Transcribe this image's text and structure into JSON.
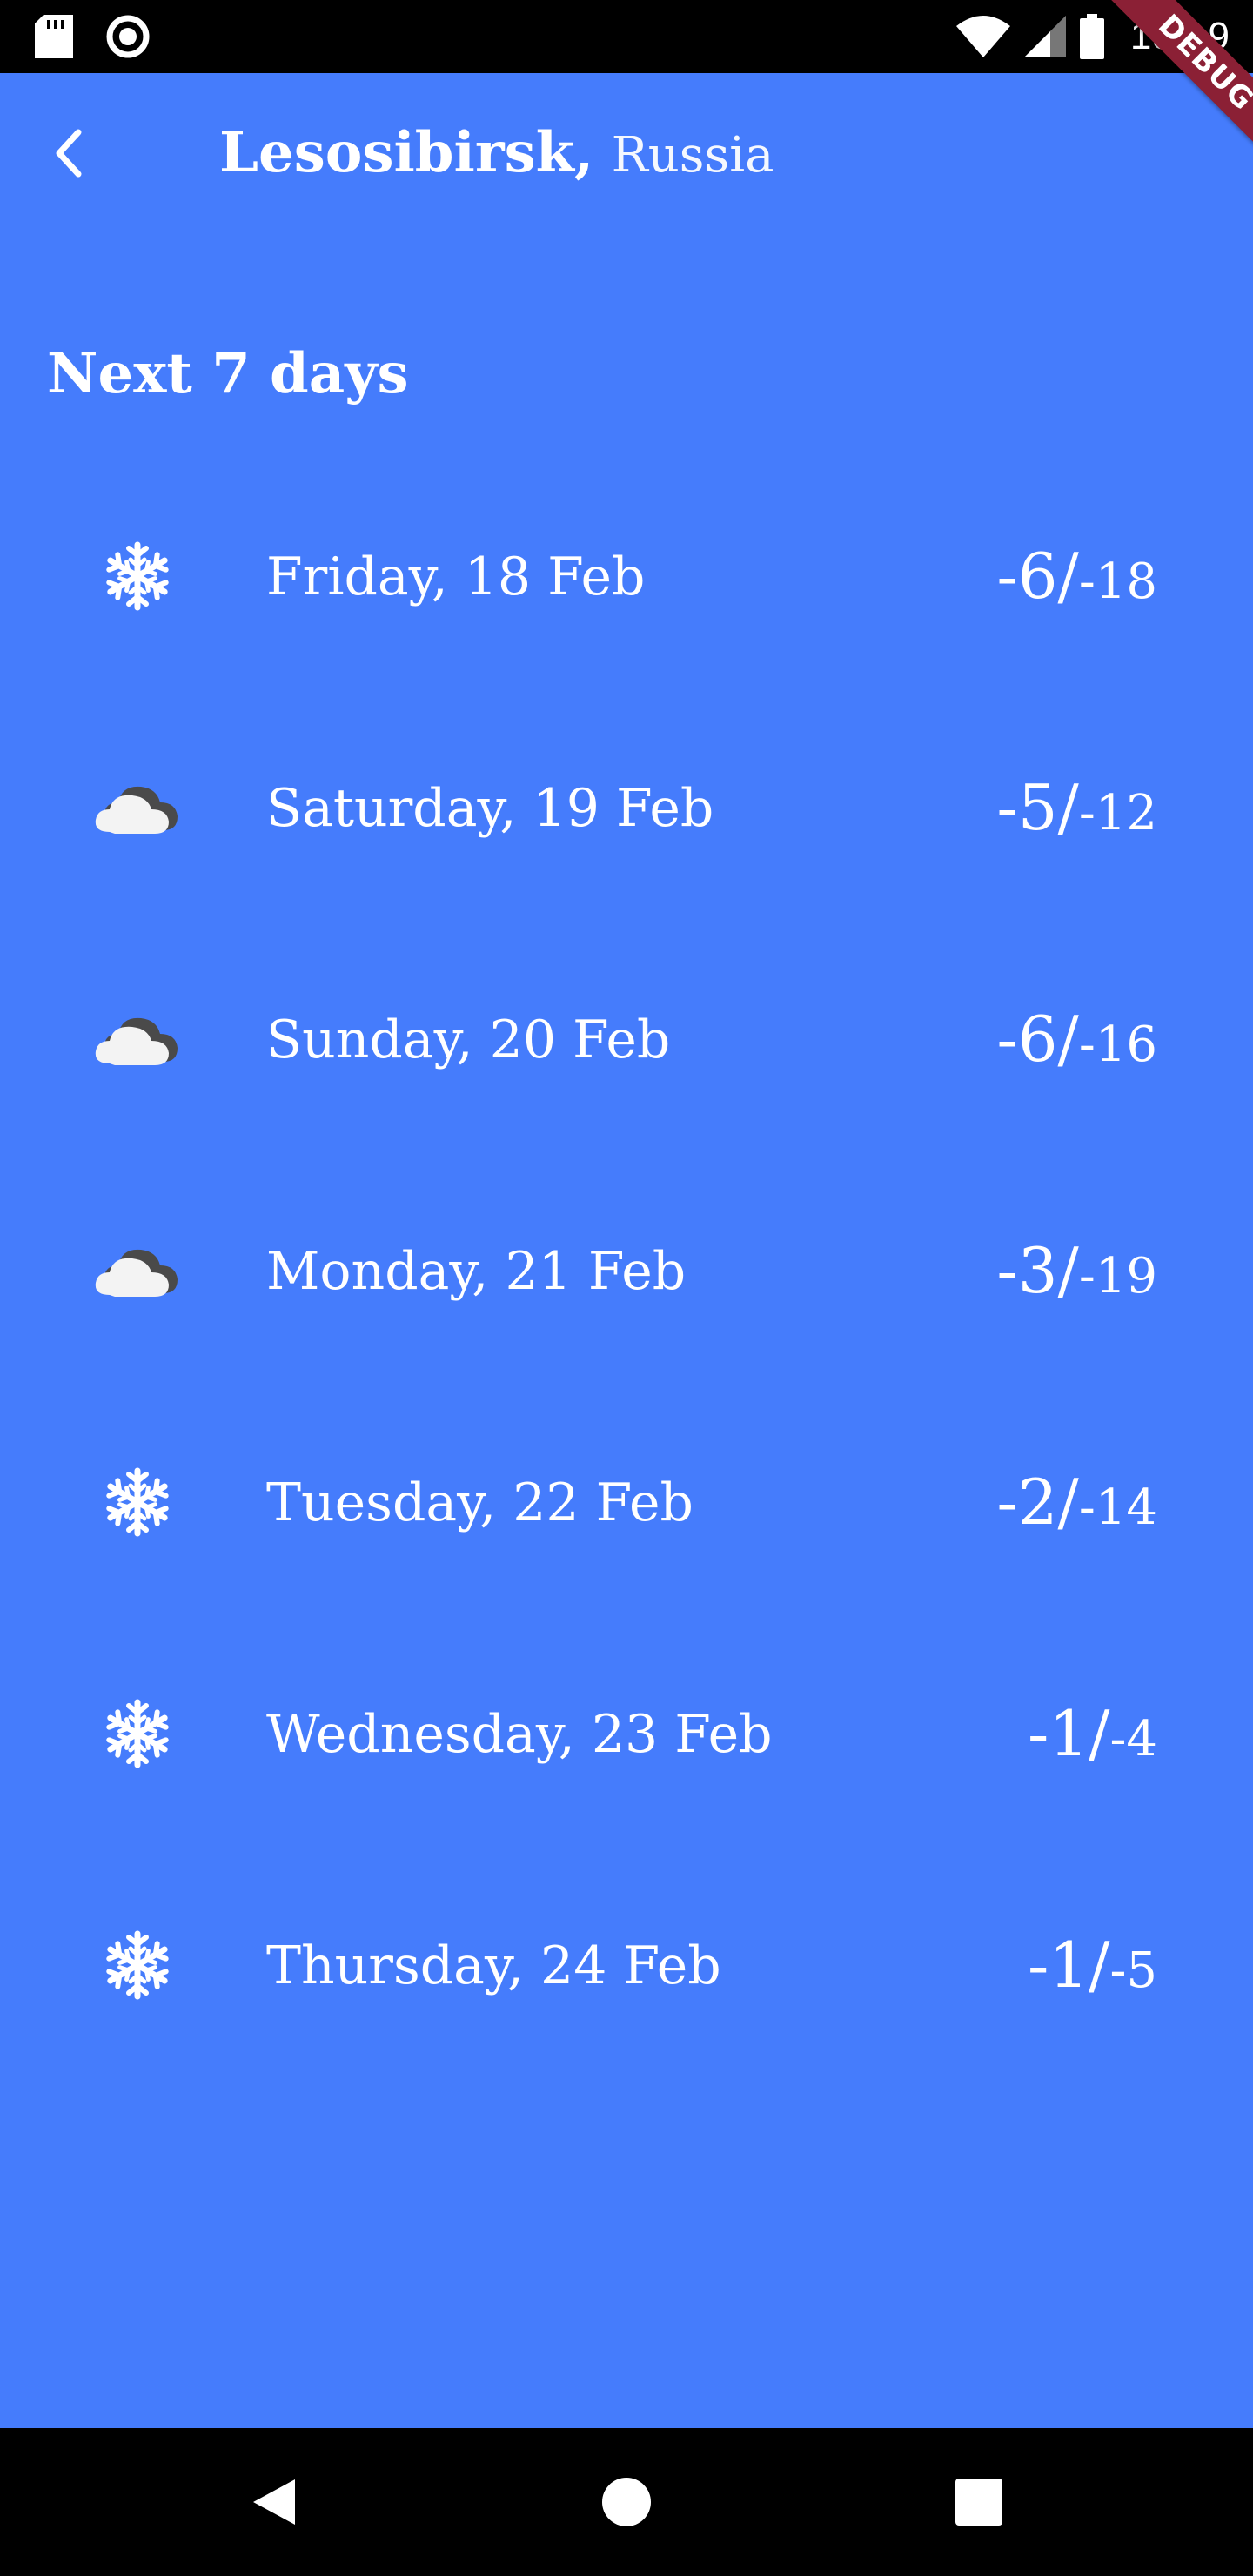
{
  "status_bar": {
    "time": "15:19",
    "icons": [
      "sd-card-icon",
      "record-icon",
      "wifi-icon",
      "cell-signal-icon",
      "battery-icon"
    ]
  },
  "debug_banner": "DEBUG",
  "header": {
    "city": "Lesosibirsk,",
    "country": "Russia",
    "back_icon": "chevron-left-icon"
  },
  "section_title": "Next 7 days",
  "forecast": [
    {
      "icon": "snowflake-icon",
      "day": "Friday, 18 Feb",
      "high": "-6",
      "low": "-18"
    },
    {
      "icon": "cloud-icon",
      "day": "Saturday, 19 Feb",
      "high": "-5",
      "low": "-12"
    },
    {
      "icon": "cloud-icon",
      "day": "Sunday, 20 Feb",
      "high": "-6",
      "low": "-16"
    },
    {
      "icon": "cloud-icon",
      "day": "Monday, 21 Feb",
      "high": "-3",
      "low": "-19"
    },
    {
      "icon": "snowflake-icon",
      "day": "Tuesday, 22 Feb",
      "high": "-2",
      "low": "-14"
    },
    {
      "icon": "snowflake-icon",
      "day": "Wednesday, 23 Feb",
      "high": "-1",
      "low": "-4"
    },
    {
      "icon": "snowflake-icon",
      "day": "Thursday, 24 Feb",
      "high": "-1",
      "low": "-5"
    }
  ],
  "temp_separator": "/",
  "nav_bar": {
    "buttons": [
      "nav-back-icon",
      "nav-home-icon",
      "nav-recents-icon"
    ]
  },
  "colors": {
    "background": "#457cfc",
    "text": "#ffffff",
    "debug_banner": "#8b2035"
  }
}
